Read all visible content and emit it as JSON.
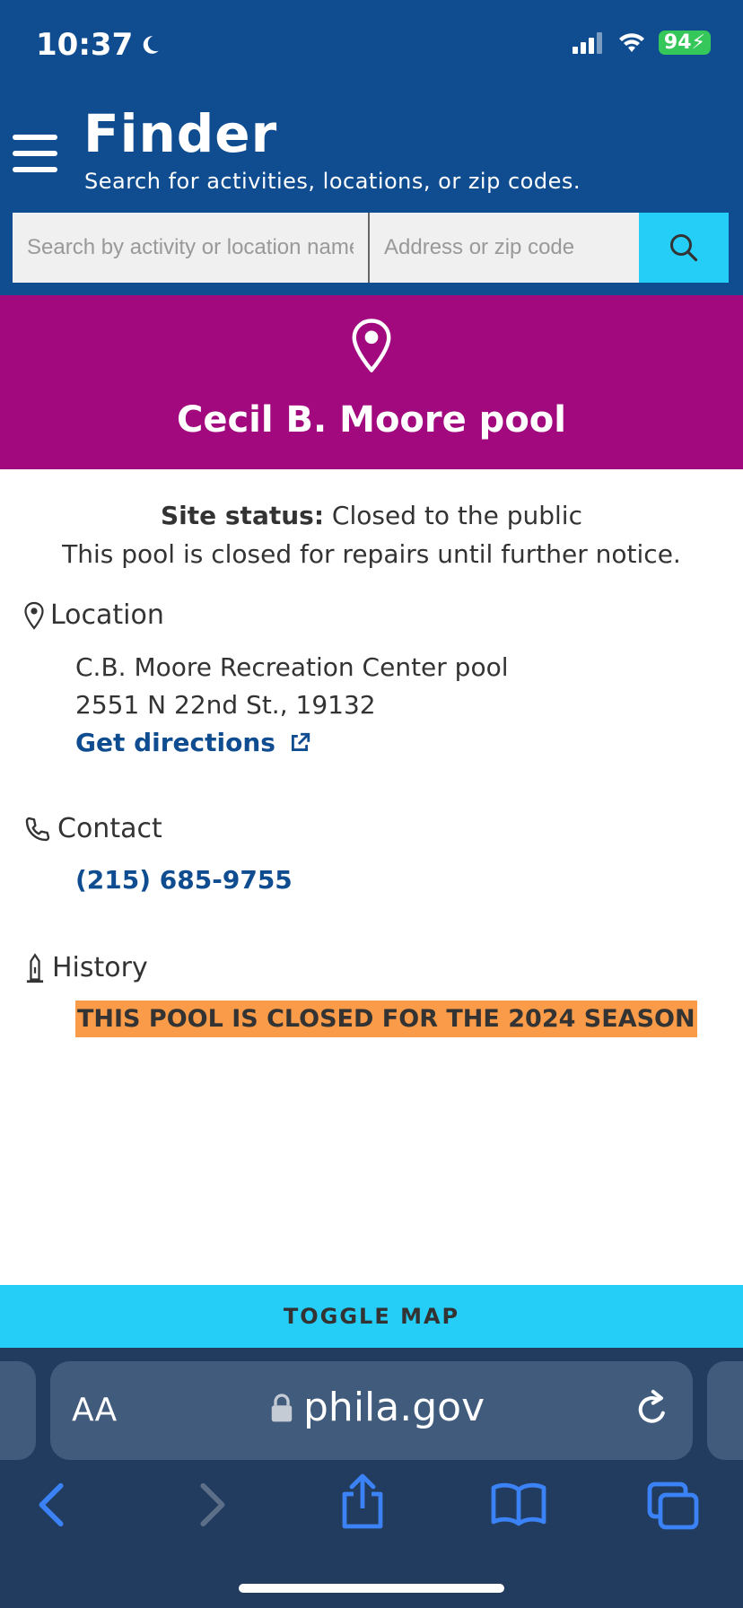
{
  "status_bar": {
    "time": "10:37",
    "battery": "94"
  },
  "header": {
    "title": "Finder",
    "subtitle": "Search for activities, locations, or zip codes.",
    "search_activity_placeholder": "Search by activity or location name",
    "search_address_placeholder": "Address or zip code"
  },
  "hero": {
    "title": "Cecil B. Moore pool"
  },
  "site_status": {
    "label": "Site status:",
    "value": "Closed to the public",
    "note": "This pool is closed for repairs until further notice."
  },
  "location": {
    "heading": "Location",
    "name": "C.B. Moore Recreation Center pool",
    "address": "2551 N 22nd St., 19132",
    "directions_label": "Get directions"
  },
  "contact": {
    "heading": "Contact",
    "phone": "(215) 685-9755"
  },
  "history": {
    "heading": "History",
    "notice": "THIS POOL IS CLOSED FOR THE 2024 SEASON"
  },
  "toggle_map_label": "TOGGLE MAP",
  "browser": {
    "text_size_label": "AA",
    "domain": "phila.gov"
  },
  "colors": {
    "header_blue": "#0f4d90",
    "hero_magenta": "#a2097f",
    "accent_cyan": "#25cef7",
    "highlight_orange": "#f99b48"
  }
}
